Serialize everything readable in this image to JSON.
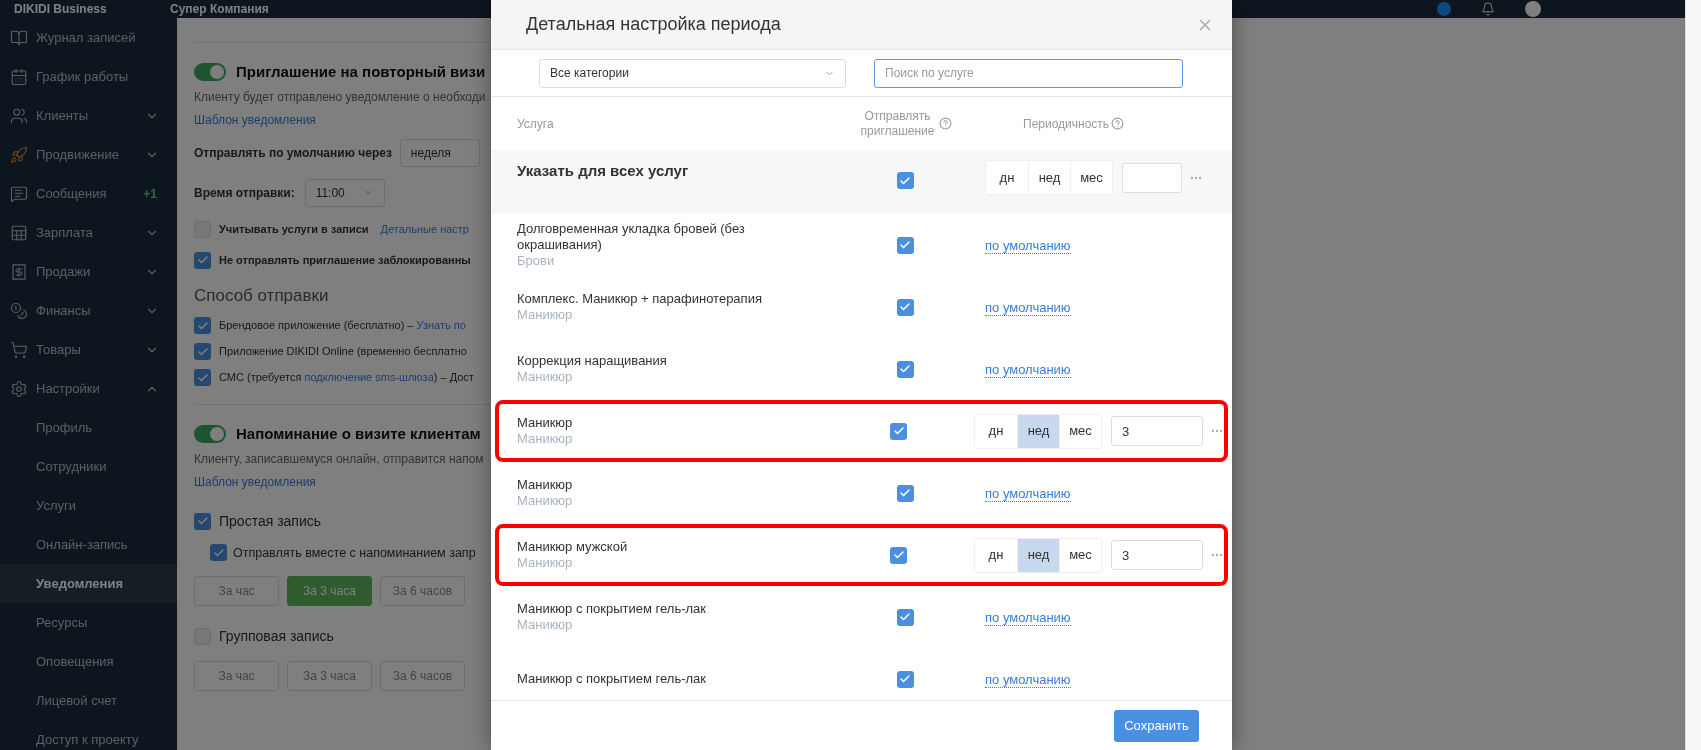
{
  "header": {
    "brand": "DIKIDI Business",
    "company": "Супер Компания"
  },
  "sidebar": {
    "items": [
      {
        "label": "Журнал записей",
        "kind": "link",
        "selected": false
      },
      {
        "label": "График работы",
        "kind": "link",
        "selected": false
      },
      {
        "label": "Клиенты",
        "kind": "group",
        "expanded": false,
        "selected": false
      },
      {
        "label": "Продвижение",
        "kind": "group",
        "expanded": false,
        "selected": false
      },
      {
        "label": "Сообщения",
        "kind": "link",
        "badge": "+1",
        "selected": false
      },
      {
        "label": "Зарплата",
        "kind": "group",
        "expanded": false,
        "selected": false
      },
      {
        "label": "Продажи",
        "kind": "group",
        "expanded": false,
        "selected": false
      },
      {
        "label": "Финансы",
        "kind": "group",
        "expanded": false,
        "selected": false
      },
      {
        "label": "Товары",
        "kind": "group",
        "expanded": false,
        "selected": false
      },
      {
        "label": "Настройки",
        "kind": "group",
        "expanded": true,
        "selected": false,
        "children": [
          {
            "label": "Профиль",
            "selected": false
          },
          {
            "label": "Сотрудники",
            "selected": false
          },
          {
            "label": "Услуги",
            "selected": false
          },
          {
            "label": "Онлайн-запись",
            "selected": false
          },
          {
            "label": "Уведомления",
            "selected": true
          },
          {
            "label": "Ресурсы",
            "selected": false
          },
          {
            "label": "Оповещения",
            "selected": false
          },
          {
            "label": "Лицевой счет",
            "selected": false
          },
          {
            "label": "Доступ к проекту",
            "selected": false
          }
        ]
      }
    ]
  },
  "invite_section": {
    "enabled": true,
    "title": "Приглашение на повторный визи",
    "description": "Клиенту будет отправлено уведомление о необходи",
    "template_link": "Шаблон уведомления",
    "default_label": "Отправлять по умолчанию через",
    "default_value": "неделя",
    "time_label": "Время отправки:",
    "time_value": "11:00",
    "options": [
      {
        "label": "Учитывать услуги в записи",
        "checked": false,
        "link": "Детальные настр"
      },
      {
        "label": "Не отправлять приглашение заблокированны",
        "checked": true
      }
    ],
    "methods_title": "Способ отправки",
    "methods": [
      {
        "text": "Брендовое приложение (бесплатно) – ",
        "link": "Узнать по",
        "checked": true
      },
      {
        "text": "Приложение DIKIDI Online (временно бесплатно",
        "checked": true
      },
      {
        "text": "СМС (требуется ",
        "link": "подключение sms-шлюза",
        "after": ") – Дост",
        "checked": true
      }
    ]
  },
  "reminder_section": {
    "enabled": true,
    "title": "Напоминание о визите клиентам",
    "description": "Клиенту, записавшемуся онлайн, отправится напом",
    "template_link": "Шаблон уведомления",
    "groups": [
      {
        "label": "Простая запись",
        "checked": true,
        "sub": {
          "label": "Отправлять вместе с напоминанием запр",
          "checked": true
        },
        "times": [
          {
            "label": "За час",
            "selected": false
          },
          {
            "label": "За 3 часа",
            "selected": true
          },
          {
            "label": "За 6 часов",
            "selected": false
          }
        ]
      },
      {
        "label": "Групповая запись",
        "checked": false,
        "times": [
          {
            "label": "За час",
            "selected": false
          },
          {
            "label": "За 3 часа",
            "selected": false
          },
          {
            "label": "За 6 часов",
            "selected": false
          }
        ]
      }
    ]
  },
  "modal": {
    "title": "Детальная настройка периода",
    "category_select": "Все категории",
    "search": {
      "placeholder": "Поиск по услуге"
    },
    "columns": [
      "Услуга",
      "Отправлять приглашение",
      "Периодичность"
    ],
    "rows": [
      {
        "kind": "all",
        "name": "Указать для всех услуг",
        "checked": true,
        "highlighted": false,
        "period": {
          "kind": "custom",
          "units": [
            {
              "label": "дн",
              "selected": false
            },
            {
              "label": "нед",
              "selected": false
            },
            {
              "label": "мес",
              "selected": false
            }
          ]
        }
      },
      {
        "kind": "service",
        "name": "Долговременная укладка бровей (без окрашивания)",
        "category": "Брови",
        "checked": true,
        "highlighted": false,
        "period": {
          "kind": "default",
          "link": "по умолчанию"
        }
      },
      {
        "kind": "service",
        "name": "Комплекс. Маникюр + парафинотерапия",
        "category": "Маникюр",
        "checked": true,
        "highlighted": false,
        "period": {
          "kind": "default",
          "link": "по умолчанию"
        }
      },
      {
        "kind": "service",
        "name": "Коррекция наращивания",
        "category": "Маникюр",
        "checked": true,
        "highlighted": false,
        "period": {
          "kind": "default",
          "link": "по умолчанию"
        }
      },
      {
        "kind": "service",
        "name": "Маникюр",
        "category": "Маникюр",
        "checked": true,
        "highlighted": true,
        "period": {
          "kind": "custom",
          "units": [
            {
              "label": "дн",
              "selected": false
            },
            {
              "label": "нед",
              "selected": true
            },
            {
              "label": "мес",
              "selected": false
            }
          ],
          "value": "3"
        }
      },
      {
        "kind": "service",
        "name": "Маникюр",
        "category": "Маникюр",
        "checked": true,
        "highlighted": false,
        "period": {
          "kind": "default",
          "link": "по умолчанию"
        }
      },
      {
        "kind": "service",
        "name": "Маникюр мужской",
        "category": "Маникюр",
        "checked": true,
        "highlighted": true,
        "period": {
          "kind": "custom",
          "units": [
            {
              "label": "дн",
              "selected": false
            },
            {
              "label": "нед",
              "selected": true
            },
            {
              "label": "мес",
              "selected": false
            }
          ],
          "value": "3"
        }
      },
      {
        "kind": "service",
        "name": "Маникюр с покрытием гель-лак",
        "category": "Маникюр",
        "checked": true,
        "highlighted": false,
        "period": {
          "kind": "default",
          "link": "по умолчанию"
        }
      },
      {
        "kind": "service",
        "name": "Маникюр с покрытием гель-лак",
        "checked": true,
        "highlighted": false,
        "period": {
          "kind": "default",
          "link": "по умолчанию"
        }
      }
    ],
    "save_button": "Сохранить"
  }
}
